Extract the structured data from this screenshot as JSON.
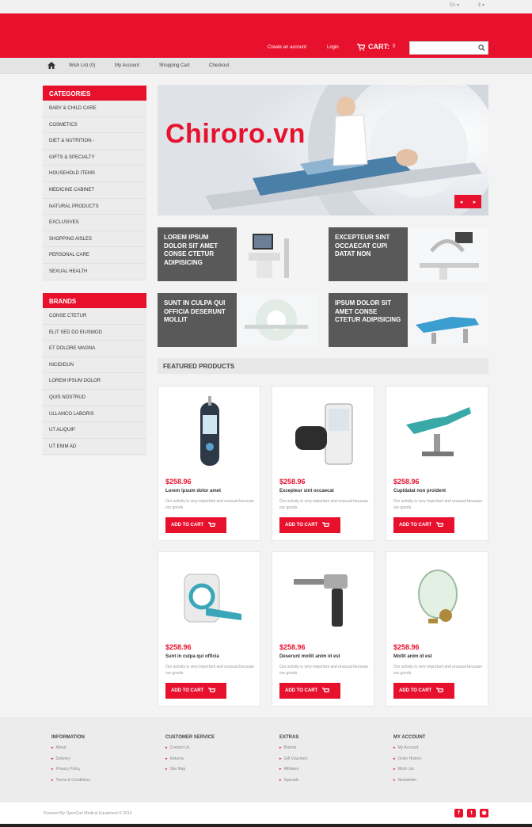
{
  "topbar": {
    "language": "En",
    "currency": "$"
  },
  "header": {
    "create_account": "Create an account",
    "login": "Login",
    "cart_label": "CART:",
    "cart_count": "0",
    "search_placeholder": ""
  },
  "nav": {
    "wishlist": "Wish List (0)",
    "account": "My Account",
    "cart": "Shopping Cart",
    "checkout": "Checkout"
  },
  "categories": {
    "title": "CATEGORIES",
    "items": [
      "BABY & CHILD CARE",
      "COSMETICS",
      "DIET & NUTRITION -",
      "GIFTS & SPECIALTY",
      "HOUSEHOLD ITEMS",
      "MEDICINE CABINET",
      "NATURAL PRODUCTS",
      "EXCLUSIVES",
      "SHOPPING AISLES",
      "PERSONAL CARE",
      "SEXUAL HEALTH"
    ]
  },
  "brands": {
    "title": "BRANDS",
    "items": [
      "CONSE CTETUR",
      "ELIT SED DO EIUSMOD",
      "ET DOLORE MAGNA",
      "INCIDIDUN",
      "LOREM IPSUM DOLOR",
      "QUIS NOSTRUD",
      "ULLAMCO LABORIS",
      "UT ALIQUIP",
      "UT ENIM AD"
    ]
  },
  "watermark": "Chiroro.vn",
  "banners": [
    {
      "text": "LOREM IPSUM DOLOR SIT AMET CONSE CTETUR ADIPISICING"
    },
    {
      "text": "EXCEPTEUR SINT OCCAECAT CUPI DATAT NON"
    },
    {
      "text": "SUNT IN CULPA QUI OFFICIA DESERUNT MOLLIT"
    },
    {
      "text": "IPSUM DOLOR SIT AMET CONSE CTETUR ADIPISICING"
    }
  ],
  "featured_title": "FEATURED PRODUCTS",
  "products": [
    {
      "price": "$258.96",
      "name": "Lorem ipsum dolor amet",
      "desc": "Our activity is very important and unusual because our goods.",
      "button": "ADD TO CART",
      "icon": "glucose-meter"
    },
    {
      "price": "$258.96",
      "name": "Excepteur sint occaecat",
      "desc": "Our activity is very important and unusual because our goods.",
      "button": "ADD TO CART",
      "icon": "blood-pressure-monitor"
    },
    {
      "price": "$258.96",
      "name": "Cupidatat non proident",
      "desc": "Our activity is very important and unusual because our goods.",
      "button": "ADD TO CART",
      "icon": "examination-chair"
    },
    {
      "price": "$258.96",
      "name": "Sunt in culpa qui officia",
      "desc": "Our activity is very important and unusual because our goods.",
      "button": "ADD TO CART",
      "icon": "ct-scanner"
    },
    {
      "price": "$258.96",
      "name": "Deserunt mollit anim id est",
      "desc": "Our activity is very important and unusual because our goods.",
      "button": "ADD TO CART",
      "icon": "surgical-drill"
    },
    {
      "price": "$258.96",
      "name": "Mollit anim id est",
      "desc": "Our activity is very important and unusual because our goods.",
      "button": "ADD TO CART",
      "icon": "oxygen-mask"
    }
  ],
  "footer": {
    "columns": [
      {
        "title": "INFORMATION",
        "links": [
          "About",
          "Delivery",
          "Privacy Policy",
          "Terms & Conditions"
        ]
      },
      {
        "title": "CUSTOMER SERVICE",
        "links": [
          "Contact Us",
          "Returns",
          "Site Map"
        ]
      },
      {
        "title": "EXTRAS",
        "links": [
          "Brands",
          "Gift Vouchers",
          "Affiliates",
          "Specials"
        ]
      },
      {
        "title": "MY ACCOUNT",
        "links": [
          "My Account",
          "Order History",
          "Wish List",
          "Newsletter"
        ]
      }
    ],
    "powered": "Powered By OpenCart Medical Equipment © 2014"
  },
  "colors": {
    "accent": "#e8112d",
    "dark_panel": "#595959"
  }
}
